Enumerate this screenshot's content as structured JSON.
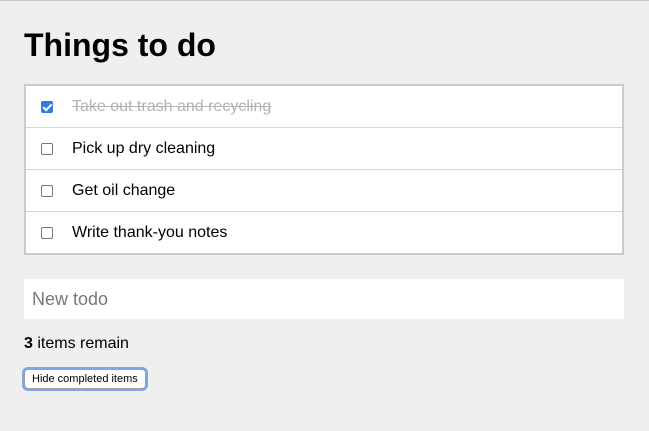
{
  "page": {
    "title": "Things to do"
  },
  "todos": [
    {
      "text": "Take out trash and recycling",
      "done": true
    },
    {
      "text": "Pick up dry cleaning",
      "done": false
    },
    {
      "text": "Get oil change",
      "done": false
    },
    {
      "text": "Write thank-you notes",
      "done": false
    }
  ],
  "new_todo": {
    "placeholder": "New todo",
    "value": ""
  },
  "status": {
    "remaining_count": "3",
    "remaining_label": " items remain"
  },
  "actions": {
    "hide_completed_label": "Hide completed items"
  },
  "colors": {
    "background": "#efefef",
    "checkbox_checked": "#2f7ae5",
    "done_text": "#b3b3b3",
    "focus_ring": "#7aa7f0"
  },
  "icons": {
    "checked": "checkbox-checked-icon",
    "unchecked": "checkbox-unchecked-icon"
  }
}
